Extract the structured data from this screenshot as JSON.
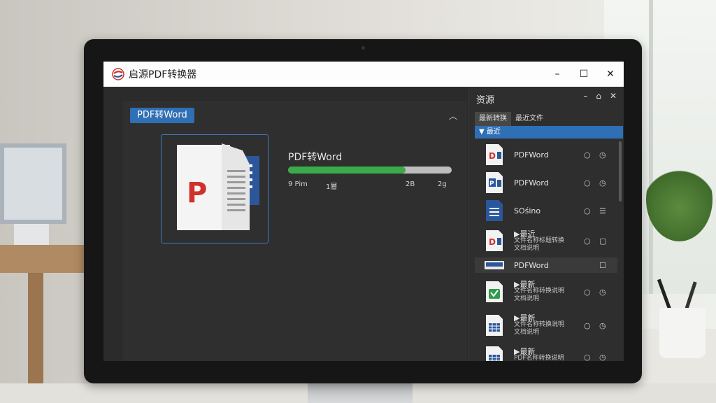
{
  "app": {
    "title": "启源PDF转换器",
    "window_controls": {
      "minimize": "–",
      "maximize": "☐",
      "close": "✕"
    }
  },
  "main": {
    "section_label": "PDF转Word",
    "collapse_icon": "chevron-up",
    "task": {
      "file_name": "PDF转Word",
      "progress": 0.72,
      "meta": [
        "9 Pim",
        "1層",
        "2B",
        "2g"
      ]
    }
  },
  "side": {
    "title": "资源",
    "controls": [
      "–",
      "⌂",
      "✕"
    ],
    "tabs": [
      "最新转换",
      "最近文件"
    ],
    "group_label": "▼ 最近",
    "items": [
      {
        "icon": "pdf",
        "title": "PDFWord",
        "sub": "",
        "a1": "○",
        "a2": "◷"
      },
      {
        "icon": "word",
        "title": "PDFWord",
        "sub": "",
        "a1": "○",
        "a2": "◷"
      },
      {
        "icon": "doc",
        "title": "SOśino",
        "sub": "",
        "a1": "○",
        "a2": "☰"
      },
      {
        "icon": "pdf",
        "title": "▶最近",
        "sub": "文件名称标题转换\n文档说明",
        "a1": "○",
        "a2": "▢"
      },
      {
        "icon": "blue-bar",
        "title": "PDFWord",
        "sub": "",
        "a1": "",
        "a2": "☐"
      },
      {
        "icon": "green",
        "title": "▶最新",
        "sub": "文件名称转换说明\n文档说明",
        "a1": "○",
        "a2": "◷"
      },
      {
        "icon": "table",
        "title": "▶最新",
        "sub": "文件名称转换说明\n文档说明",
        "a1": "○",
        "a2": "◷"
      },
      {
        "icon": "table",
        "title": "▶最新",
        "sub": "PDF名称转换说明",
        "a1": "○",
        "a2": "◷"
      }
    ]
  },
  "colors": {
    "accent": "#2f6fb5",
    "progress": "#3aaa4a",
    "pdf_red": "#d0312d",
    "word_blue": "#2b579a"
  }
}
